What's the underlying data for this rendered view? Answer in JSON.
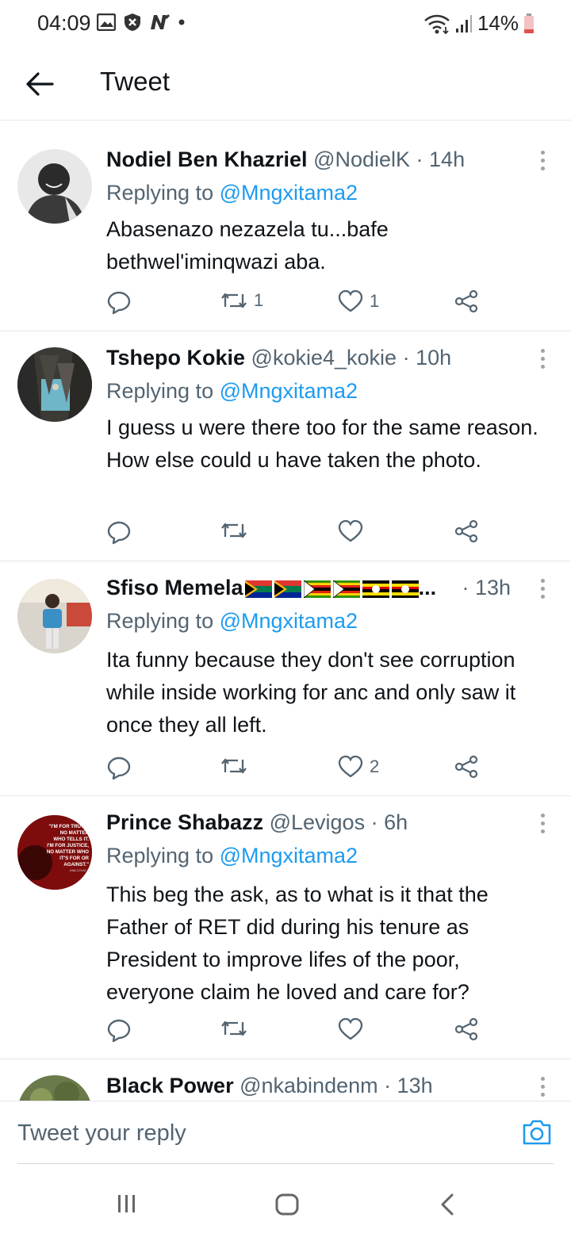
{
  "status_bar": {
    "time": "04:09",
    "battery": "14%",
    "icons_left": [
      "gallery-icon",
      "shield-icon",
      "n-icon",
      "dot"
    ],
    "icons_right": [
      "wifi-icon",
      "signal-icon",
      "battery-icon"
    ]
  },
  "header": {
    "title": "Tweet"
  },
  "tweets": [
    {
      "name": "Nodiel Ben Khazriel",
      "handle": "@NodielK",
      "time": "· 14h",
      "replying_prefix": "Replying to ",
      "replying_to": "@Mngxitama2",
      "text": "Abasenazo nezazela tu...bafe bethwel'iminqwazi aba.",
      "retweets": "1",
      "likes": "1"
    },
    {
      "name": "Tshepo Kokie",
      "handle": "@kokie4_kokie",
      "time": "· 10h",
      "replying_prefix": "Replying to ",
      "replying_to": "@Mngxitama2",
      "text": "I guess u were there too for the same reason. How else could u have taken the photo.",
      "retweets": "",
      "likes": ""
    },
    {
      "name": "Sfiso Memela",
      "name_suffix": "...",
      "handle": "",
      "time": "· 13h",
      "replying_prefix": "Replying to ",
      "replying_to": "@Mngxitama2",
      "text": "Ita funny because they don't see corruption while inside working for anc and only saw it once they all left.",
      "retweets": "",
      "likes": "2"
    },
    {
      "name": "Prince Shabazz",
      "handle": "@Levigos",
      "time": "· 6h",
      "replying_prefix": "Replying to ",
      "replying_to": "@Mngxitama2",
      "text": "This beg the ask, as to what is it that the Father of RET did during his tenure  as President to improve lifes of the poor, everyone claim he loved and care for?",
      "retweets": "",
      "likes": ""
    },
    {
      "name": "Black Power",
      "handle": "@nkabindenm",
      "time": "· 13h"
    }
  ],
  "avatar4_text": [
    "\"I'M FOR TRUTH,",
    "NO MATTER",
    "WHO TELLS IT.",
    "I'M FOR JUSTICE,",
    "NO MATTER WHO",
    "IT'S FOR OR",
    "AGAINST.\"",
    "-MALCOLM X"
  ],
  "reply_bar": {
    "placeholder": "Tweet your reply"
  },
  "colors": {
    "link": "#1d9bf0",
    "secondary": "#536471",
    "primary_text": "#0f1419"
  }
}
